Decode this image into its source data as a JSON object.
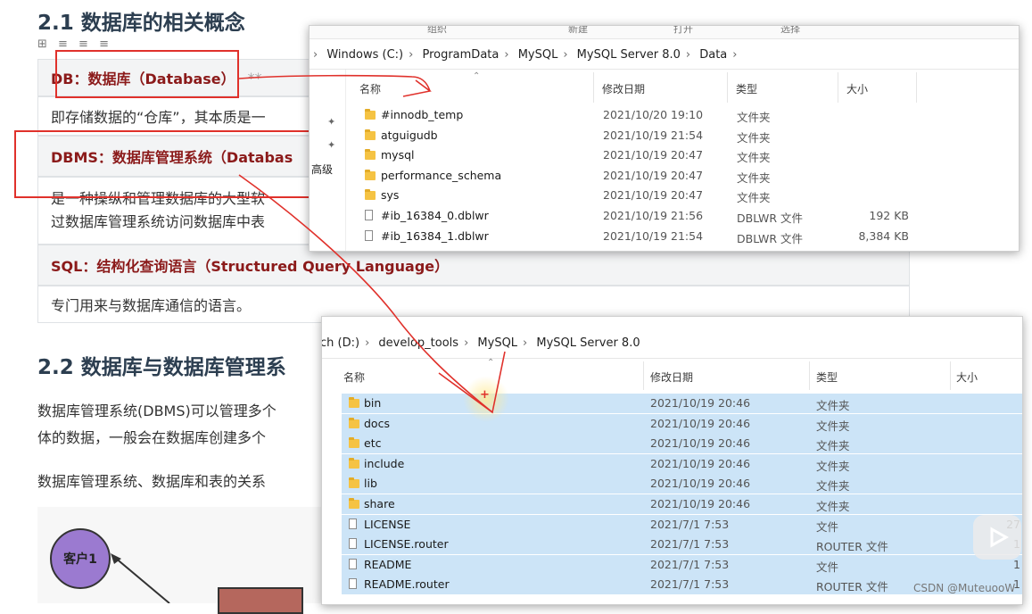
{
  "doc": {
    "section1_title": "2.1 数据库的相关概念",
    "rows": [
      {
        "head": "DB：数据库（Database）"
      },
      {
        "body": "即存储数据的“仓库”，其本质是一"
      },
      {
        "head": "DBMS：数据库管理系统（Databas"
      },
      {
        "body_line1": "是一种操纵和管理数据库的大型软",
        "body_line2": "过数据库管理系统访问数据库中表"
      },
      {
        "head": "SQL：结构化查询语言（Structured Query Language）"
      },
      {
        "body": "专门用来与数据库通信的语言。"
      }
    ],
    "section2_title": "2.2 数据库与数据库管理系",
    "para1_line1": "数据库管理系统(DBMS)可以管理多个",
    "para1_line2": "体的数据，一般会在数据库创建多个",
    "para2": "数据库管理系统、数据库和表的关系",
    "diagram_client": "客户1",
    "asterisks": "**"
  },
  "win1": {
    "toolbar_labels": [
      "组织",
      "新建",
      "打开",
      "选择"
    ],
    "breadcrumb": [
      "Windows (C:)",
      "ProgramData",
      "MySQL",
      "MySQL Server 8.0",
      "Data"
    ],
    "side_label": "高级",
    "columns": {
      "name": "名称",
      "date": "修改日期",
      "type": "类型",
      "size": "大小"
    },
    "files": [
      {
        "name": "#innodb_temp",
        "date": "2021/10/20 19:10",
        "type": "文件夹",
        "size": "",
        "icon": "folder-icon"
      },
      {
        "name": "atguigudb",
        "date": "2021/10/19 21:54",
        "type": "文件夹",
        "size": "",
        "icon": "folder-icon"
      },
      {
        "name": "mysql",
        "date": "2021/10/19 20:47",
        "type": "文件夹",
        "size": "",
        "icon": "folder-icon"
      },
      {
        "name": "performance_schema",
        "date": "2021/10/19 20:47",
        "type": "文件夹",
        "size": "",
        "icon": "folder-icon"
      },
      {
        "name": "sys",
        "date": "2021/10/19 20:47",
        "type": "文件夹",
        "size": "",
        "icon": "folder-icon"
      },
      {
        "name": "#ib_16384_0.dblwr",
        "date": "2021/10/19 21:56",
        "type": "DBLWR 文件",
        "size": "192 KB",
        "icon": "file-icon"
      },
      {
        "name": "#ib_16384_1.dblwr",
        "date": "2021/10/19 21:54",
        "type": "DBLWR 文件",
        "size": "8,384 KB",
        "icon": "file-icon"
      }
    ]
  },
  "win2": {
    "breadcrumb": [
      "ch (D:)",
      "develop_tools",
      "MySQL",
      "MySQL Server 8.0"
    ],
    "columns": {
      "name": "名称",
      "date": "修改日期",
      "type": "类型",
      "size": "大小"
    },
    "files": [
      {
        "name": "bin",
        "date": "2021/10/19 20:46",
        "type": "文件夹",
        "size": "",
        "icon": "folder-icon"
      },
      {
        "name": "docs",
        "date": "2021/10/19 20:46",
        "type": "文件夹",
        "size": "",
        "icon": "folder-icon"
      },
      {
        "name": "etc",
        "date": "2021/10/19 20:46",
        "type": "文件夹",
        "size": "",
        "icon": "folder-icon"
      },
      {
        "name": "include",
        "date": "2021/10/19 20:46",
        "type": "文件夹",
        "size": "",
        "icon": "folder-icon"
      },
      {
        "name": "lib",
        "date": "2021/10/19 20:46",
        "type": "文件夹",
        "size": "",
        "icon": "folder-icon"
      },
      {
        "name": "share",
        "date": "2021/10/19 20:46",
        "type": "文件夹",
        "size": "",
        "icon": "folder-icon"
      },
      {
        "name": "LICENSE",
        "date": "2021/7/1 7:53",
        "type": "文件",
        "size": "27",
        "icon": "file-icon"
      },
      {
        "name": "LICENSE.router",
        "date": "2021/7/1 7:53",
        "type": "ROUTER 文件",
        "size": "1",
        "icon": "file-icon"
      },
      {
        "name": "README",
        "date": "2021/7/1 7:53",
        "type": "文件",
        "size": "1",
        "icon": "file-icon"
      },
      {
        "name": "README.router",
        "date": "2021/7/1 7:53",
        "type": "ROUTER 文件",
        "size": "1",
        "icon": "file-icon"
      }
    ]
  },
  "watermark": "CSDN @MuteuooW",
  "colors": {
    "annotation_red": "#e0312b",
    "selection_blue": "#cce4f7",
    "heading_dark_red": "#8b1a1a",
    "folder_yellow": "#f5c343"
  }
}
